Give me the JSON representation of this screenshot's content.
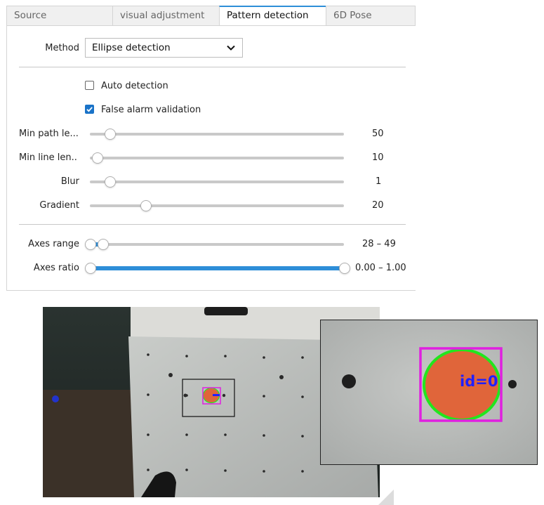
{
  "tabs": [
    {
      "label": "Source",
      "active": false
    },
    {
      "label": "visual adjustment",
      "active": false
    },
    {
      "label": "Pattern detection",
      "active": true
    },
    {
      "label": "6D Pose",
      "active": false
    }
  ],
  "method": {
    "label": "Method",
    "value": "Ellipse detection"
  },
  "checkboxes": {
    "auto_detection": {
      "label": "Auto detection",
      "checked": false
    },
    "false_alarm": {
      "label": "False alarm validation",
      "checked": true
    }
  },
  "sliders": {
    "min_path": {
      "label": "Min path le...",
      "value": "50",
      "level": 0.05
    },
    "min_line": {
      "label": "Min line len...",
      "value": "10",
      "level": 0.0
    },
    "blur": {
      "label": "Blur",
      "value": "1",
      "level": 0.05
    },
    "gradient": {
      "label": "Gradient",
      "value": "20",
      "level": 0.19
    }
  },
  "range_sliders": {
    "axes_range": {
      "label": "Axes range",
      "value": "28 – 49",
      "low": 0.0,
      "high": 0.05
    },
    "axes_ratio": {
      "label": "Axes ratio",
      "value": "0.00 – 1.00",
      "low": 0.0,
      "high": 1.0
    }
  },
  "detection": {
    "label": "id=0"
  },
  "colors": {
    "accent": "#2e8ed8",
    "ellipse": "#22e61e",
    "bbox": "#e020e0",
    "label": "#2020ff",
    "object": "#e0653a"
  }
}
